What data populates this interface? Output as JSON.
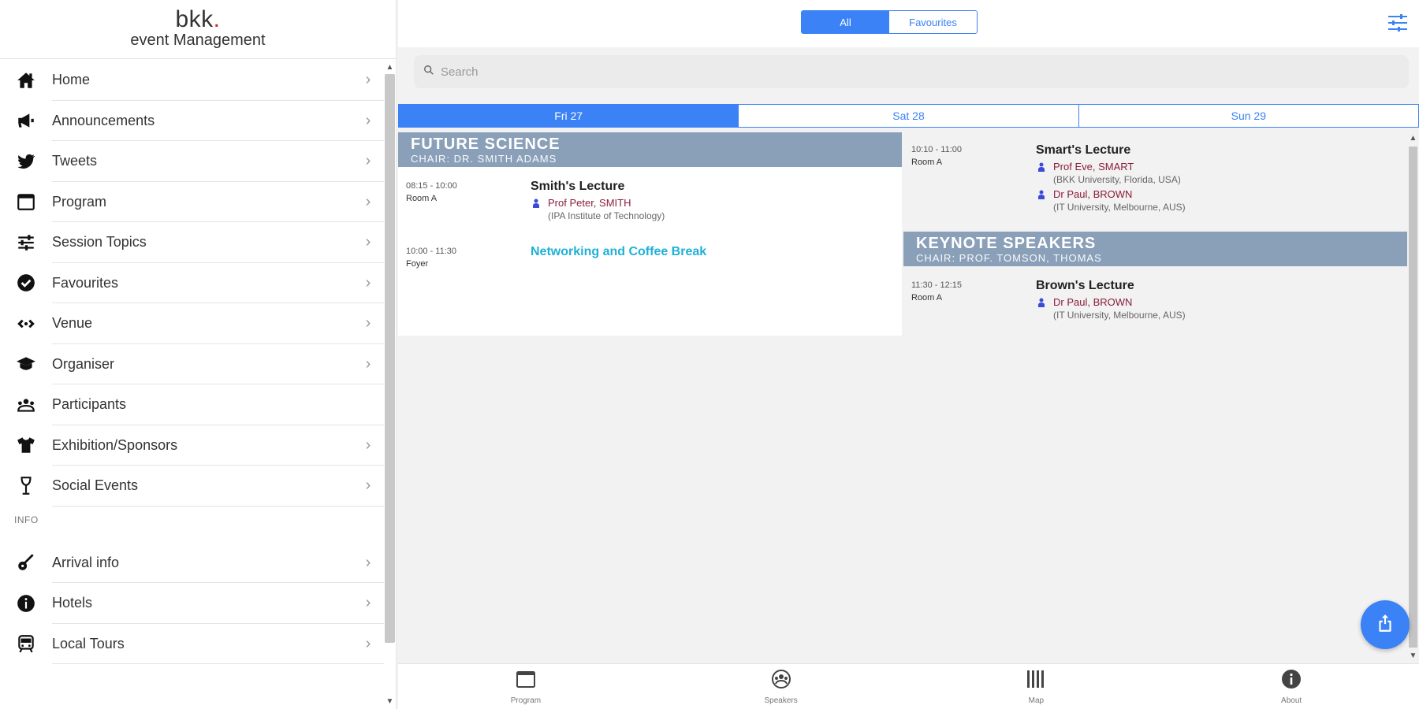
{
  "brand": {
    "name": "bkk",
    "dot": ".",
    "subtitle": "event Management"
  },
  "sidebar": {
    "items": [
      {
        "label": "Home",
        "icon": "home-icon",
        "chevron": "›"
      },
      {
        "label": "Announcements",
        "icon": "megaphone-icon",
        "chevron": "›"
      },
      {
        "label": "Tweets",
        "icon": "twitter-icon",
        "chevron": "›"
      },
      {
        "label": "Program",
        "icon": "calendar-icon",
        "chevron": "›"
      },
      {
        "label": "Session Topics",
        "icon": "sliders-icon",
        "chevron": "›"
      },
      {
        "label": "Favourites",
        "icon": "check-circle-icon",
        "chevron": "›"
      },
      {
        "label": "Venue",
        "icon": "venue-icon",
        "chevron": "›"
      },
      {
        "label": "Organiser",
        "icon": "graduation-cap-icon",
        "chevron": "›"
      },
      {
        "label": "Participants",
        "icon": "participants-icon",
        "chevron": ""
      },
      {
        "label": "Exhibition/Sponsors",
        "icon": "tshirt-icon",
        "chevron": "›"
      },
      {
        "label": "Social Events",
        "icon": "wine-glass-icon",
        "chevron": "›"
      }
    ],
    "section_label": "INFO",
    "info_items": [
      {
        "label": "Arrival info",
        "icon": "guitar-icon",
        "chevron": "›"
      },
      {
        "label": "Hotels",
        "icon": "info-icon",
        "chevron": "›"
      },
      {
        "label": "Local Tours",
        "icon": "bus-icon",
        "chevron": "›"
      }
    ]
  },
  "header": {
    "segments": [
      "All",
      "Favourites"
    ],
    "active_segment": "All"
  },
  "search": {
    "placeholder": "Search",
    "value": ""
  },
  "days": [
    "Fri 27",
    "Sat 28",
    "Sun 29"
  ],
  "active_day": "Fri 27",
  "program": {
    "left": {
      "session": {
        "title": "FUTURE SCIENCE",
        "chair": "CHAIR: DR. SMITH ADAMS"
      },
      "talks": [
        {
          "time": "08:15 - 10:00",
          "room": "Room A",
          "title": "Smith's Lecture",
          "speakers": [
            {
              "name": "Prof Peter, SMITH",
              "affiliation": "(IPA Institute of Technology)"
            }
          ]
        },
        {
          "time": "10:00 - 11:30",
          "room": "Foyer",
          "title": "Networking and Coffee Break",
          "is_break": true,
          "speakers": []
        }
      ]
    },
    "right": {
      "talks_top": [
        {
          "time": "10:10 - 11:00",
          "room": "Room A",
          "title": "Smart's Lecture",
          "speakers": [
            {
              "name": "Prof Eve, SMART",
              "affiliation": "(BKK University, Florida, USA)"
            },
            {
              "name": "Dr Paul, BROWN",
              "affiliation": "(IT University, Melbourne, AUS)"
            }
          ]
        }
      ],
      "session": {
        "title": "KEYNOTE SPEAKERS",
        "chair": "CHAIR: PROF. TOMSON, THOMAS"
      },
      "talks": [
        {
          "time": "11:30 - 12:15",
          "room": "Room A",
          "title": "Brown's Lecture",
          "speakers": [
            {
              "name": "Dr Paul, BROWN",
              "affiliation": "(IT University, Melbourne, AUS)"
            }
          ]
        }
      ]
    }
  },
  "bottom_nav": [
    {
      "label": "Program",
      "icon": "calendar-icon"
    },
    {
      "label": "Speakers",
      "icon": "speakers-icon"
    },
    {
      "label": "Map",
      "icon": "map-icon"
    },
    {
      "label": "About",
      "icon": "info-icon"
    }
  ],
  "colors": {
    "accent": "#3b82f6",
    "session_header": "#8aa0b9",
    "speaker_name": "#8a1d3a",
    "break_title": "#1fb0d6",
    "brand_dot": "#d62020"
  }
}
